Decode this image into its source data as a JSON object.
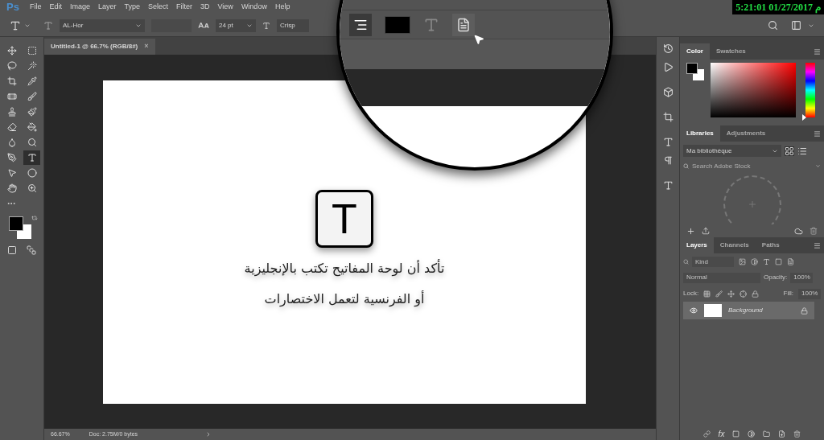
{
  "menu_bar": {
    "logo": "Ps",
    "items": [
      "File",
      "Edit",
      "Image",
      "Layer",
      "Type",
      "Select",
      "Filter",
      "3D",
      "View",
      "Window",
      "Help"
    ],
    "clock": "5:21:01 01/27/2017 م"
  },
  "options_bar": {
    "font": "AL-Hor",
    "size": "24 pt",
    "antialias": "Crisp"
  },
  "magnifier": {
    "align_selected": true
  },
  "document_tab": {
    "title": "Untitled-1 @ 66.7% (RGB/8#)",
    "close": "×"
  },
  "tools": [
    {
      "kind": "move",
      "selected": false
    },
    {
      "kind": "marquee",
      "selected": false
    },
    {
      "kind": "lasso",
      "selected": false
    },
    {
      "kind": "wand",
      "selected": false
    },
    {
      "kind": "crop",
      "selected": false
    },
    {
      "kind": "eyedropper",
      "selected": false
    },
    {
      "kind": "heal",
      "selected": false
    },
    {
      "kind": "brush",
      "selected": false
    },
    {
      "kind": "stamp",
      "selected": false
    },
    {
      "kind": "history",
      "selected": false
    },
    {
      "kind": "eraser",
      "selected": false
    },
    {
      "kind": "bucket",
      "selected": false
    },
    {
      "kind": "blur",
      "selected": false
    },
    {
      "kind": "dodge",
      "selected": false
    },
    {
      "kind": "pen",
      "selected": false
    },
    {
      "kind": "type",
      "selected": true
    },
    {
      "kind": "select",
      "selected": false
    },
    {
      "kind": "ellipse",
      "selected": false
    },
    {
      "kind": "hand",
      "selected": false
    },
    {
      "kind": "zoom",
      "selected": false
    }
  ],
  "canvas": {
    "key_letter": "T",
    "lines": [
      "تأكد أن لوحة المفاتيح تكتب بالإنجليزية",
      "أو الفرنسية لتعمل الاختصارات"
    ]
  },
  "status_bar": {
    "zoom": "66.67%",
    "doc": "Doc: 2.75M/0 bytes"
  },
  "color_panel": {
    "tabs": [
      {
        "label": "Color",
        "selected": true
      },
      {
        "label": "Swatches",
        "selected": false
      }
    ],
    "hue_slider": {
      "level": 0
    }
  },
  "libraries_panel": {
    "tabs": [
      {
        "label": "Libraries",
        "selected": true
      },
      {
        "label": "Adjustments",
        "selected": false
      }
    ],
    "library": "Ma bibliothèque",
    "search_placeholder": "Search Adobe Stock"
  },
  "layers_panel": {
    "tabs": [
      {
        "label": "Layers",
        "selected": true
      },
      {
        "label": "Channels",
        "selected": false
      },
      {
        "label": "Paths",
        "selected": false
      }
    ],
    "filter_placeholder": "Kind",
    "blend_mode": "Normal",
    "opacity_label": "Opacity:",
    "opacity": "100%",
    "lock_label": "Lock:",
    "fill_label": "Fill:",
    "fill": "100%",
    "fx": "fx",
    "layers": [
      {
        "name": "Background",
        "visible": true,
        "selected": true,
        "locked": true
      }
    ]
  }
}
